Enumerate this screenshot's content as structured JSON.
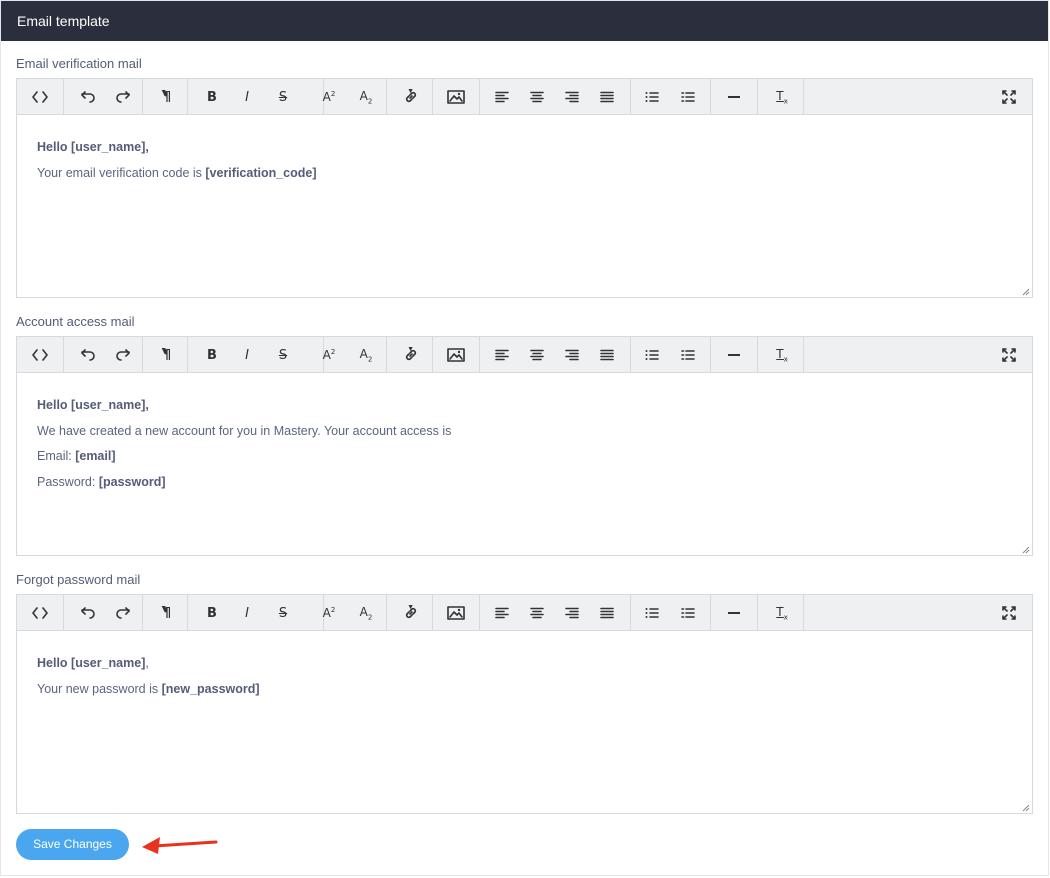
{
  "card": {
    "title": "Email template"
  },
  "toolbar": {
    "buttons": [
      "code-view",
      "undo",
      "redo",
      "paragraph",
      "bold",
      "italic",
      "strikethrough",
      "superscript",
      "subscript",
      "link",
      "image",
      "align-left",
      "align-center",
      "align-right",
      "align-justify",
      "bullet-list",
      "numbered-list",
      "horizontal-rule",
      "clear-format",
      "fullscreen"
    ]
  },
  "editors": [
    {
      "label": "Email verification mail",
      "lines": [
        {
          "text": "",
          "bold": "Hello [user_name],",
          "tail": ""
        },
        {
          "text": "Your email verification code is ",
          "bold": "[verification_code]",
          "tail": ""
        }
      ]
    },
    {
      "label": "Account access mail",
      "lines": [
        {
          "text": "",
          "bold": "Hello [user_name],",
          "tail": ""
        },
        {
          "text": "We have created a new account for you in Mastery. Your account access is",
          "bold": "",
          "tail": ""
        },
        {
          "text": "Email: ",
          "bold": "[email]",
          "tail": ""
        },
        {
          "text": "Password: ",
          "bold": "[password]",
          "tail": ""
        }
      ]
    },
    {
      "label": "Forgot password mail",
      "lines": [
        {
          "text": "",
          "bold": "Hello [user_name]",
          "tail": ","
        },
        {
          "text": "Your new password is ",
          "bold": "[new_password]",
          "tail": ""
        }
      ]
    }
  ],
  "save_button": {
    "label": "Save Changes",
    "color": "#4aa6ee"
  },
  "annotation": {
    "arrow_color": "#e8311f"
  }
}
